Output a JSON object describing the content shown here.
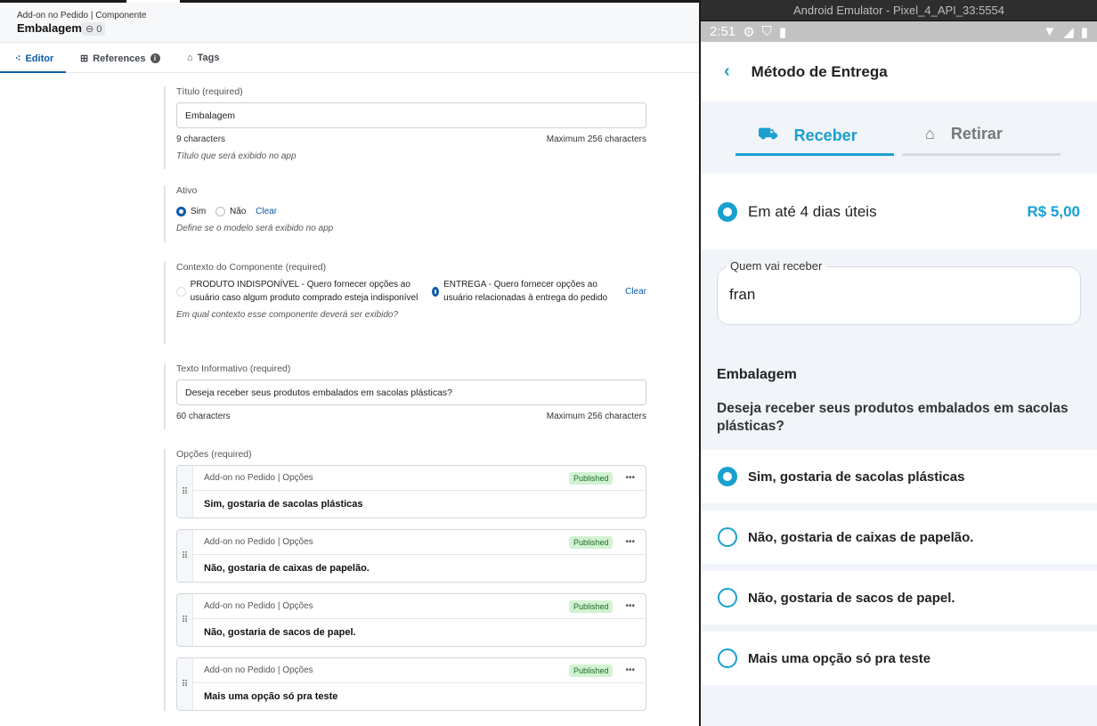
{
  "cms": {
    "breadcrumb": "Add-on no Pedido | Componente",
    "title": "Embalagem",
    "refs_count": "0",
    "tabs": [
      {
        "label": "Editor"
      },
      {
        "label": "References"
      },
      {
        "label": "Tags"
      }
    ],
    "titulo": {
      "label": "Título (required)",
      "value": "Embalagem",
      "count": "9 characters",
      "max": "Maximum 256 characters",
      "help": "Título que será exibido no app"
    },
    "ativo": {
      "label": "Ativo",
      "opt_yes": "Sim",
      "opt_no": "Não",
      "clear": "Clear",
      "help": "Define se o modelo será exibido no app"
    },
    "contexto": {
      "label": "Contexto do Componente (required)",
      "opt1": "PRODUTO INDISPONÍVEL - Quero fornecer opções ao usuário caso algum produto comprado esteja indisponível",
      "opt2": "ENTREGA - Quero fornecer opções ao usuário relacionadas à entrega do pedido",
      "clear": "Clear",
      "help": "Em qual contexto esse componente deverá ser exibido?"
    },
    "texto": {
      "label": "Texto Informativo (required)",
      "value": "Deseja receber seus produtos embalados em sacolas plásticas?",
      "count": "60 characters",
      "max": "Maximum 256 characters"
    },
    "opcoes": {
      "label": "Opções (required)",
      "items": [
        {
          "type": "Add-on no Pedido | Opções",
          "status": "Published",
          "text": "Sim, gostaria de sacolas plásticas"
        },
        {
          "type": "Add-on no Pedido | Opções",
          "status": "Published",
          "text": "Não, gostaria de caixas de papelão."
        },
        {
          "type": "Add-on no Pedido | Opções",
          "status": "Published",
          "text": "Não, gostaria de sacos de papel."
        },
        {
          "type": "Add-on no Pedido | Opções",
          "status": "Published",
          "text": "Mais uma opção só pra teste"
        }
      ]
    }
  },
  "emulator": {
    "window_title": "Android Emulator - Pixel_4_API_33:5554",
    "time": "2:51",
    "header": "Método de Entrega",
    "tab_receive": "Receber",
    "tab_pickup": "Retirar",
    "delivery_option": "Em até 4 dias úteis",
    "delivery_price": "R$ 5,00",
    "receiver_label": "Quem vai receber",
    "receiver_value": "fran",
    "section_title": "Embalagem",
    "question": "Deseja receber seus produtos embalados em sacolas plásticas?",
    "options": [
      "Sim, gostaria de sacolas plásticas",
      "Não, gostaria de caixas de papelão.",
      "Não, gostaria de sacos de papel.",
      "Mais uma opção só pra teste"
    ],
    "accent": "#1a9fd0"
  }
}
